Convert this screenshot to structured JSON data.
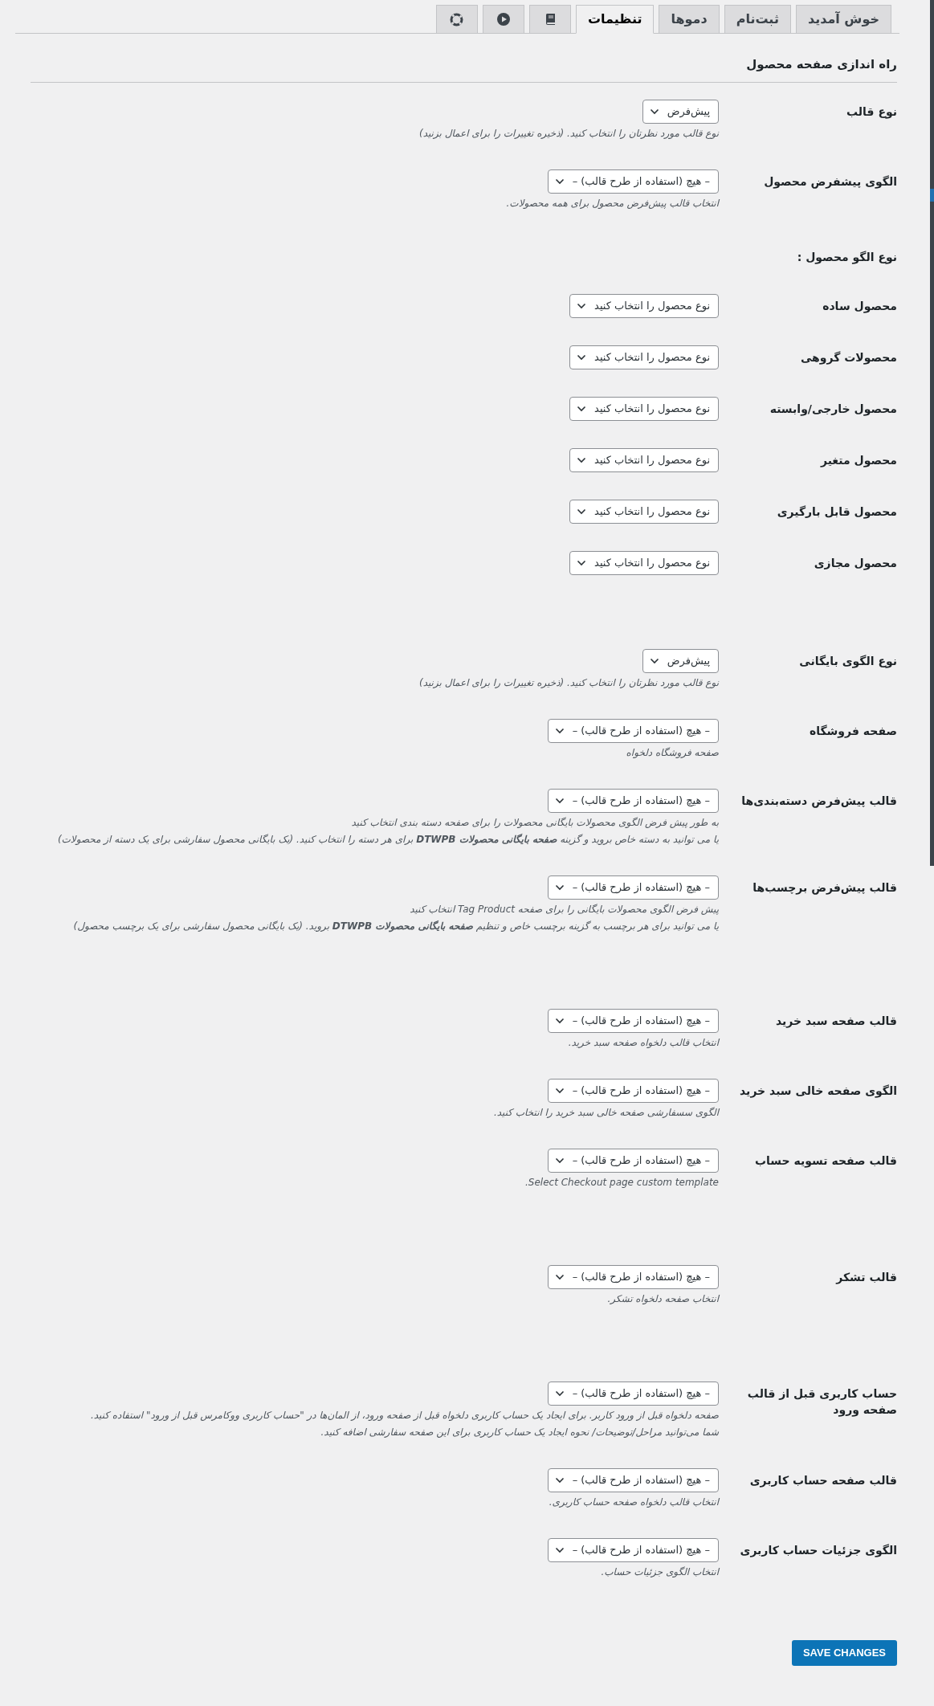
{
  "tabs": [
    {
      "kind": "text",
      "label": "خوش آمدید",
      "selected": false
    },
    {
      "kind": "text",
      "label": "ثبت‌نام",
      "selected": false
    },
    {
      "kind": "text",
      "label": "دموها",
      "selected": false
    },
    {
      "kind": "text",
      "label": "تنظیمات",
      "selected": true
    },
    {
      "kind": "book",
      "selected": false
    },
    {
      "kind": "play",
      "selected": false
    },
    {
      "kind": "lifebuoy",
      "selected": false
    }
  ],
  "sections": [
    {
      "title": "راه اندازی صفحه محصول",
      "rows": [
        {
          "label": "نوع قالب",
          "value": "پیش‌فرض",
          "description": [
            "نوع قالب مورد نظرتان را انتخاب کنید. (ذخیره تغییرات را برای اعمال بزنید)"
          ]
        },
        {
          "label": "الگوی پیشفرض محصول",
          "value": "– هیچ (استفاده از طرح قالب) –",
          "description": [
            "انتخاب قالب پیش‌فرض محصول برای همه محصولات."
          ]
        }
      ]
    },
    {
      "subtitle": "نوع الگو محصول :",
      "rows": [
        {
          "label": "محصول ساده",
          "value": "نوع محصول را انتخاب کنید"
        },
        {
          "label": "محصولات گروهی",
          "value": "نوع محصول را انتخاب کنید"
        },
        {
          "label": "محصول خارجی/وابسته",
          "value": "نوع محصول را انتخاب کنید"
        },
        {
          "label": "محصول متغیر",
          "value": "نوع محصول را انتخاب کنید"
        },
        {
          "label": "محصول قابل بارگیری",
          "value": "نوع محصول را انتخاب کنید"
        },
        {
          "label": "محصول مجازی",
          "value": "نوع محصول را انتخاب کنید"
        }
      ]
    },
    {
      "rows": [
        {
          "label": "نوع الگوی بایگانی",
          "value": "پیش‌فرض",
          "description": [
            "نوع قالب مورد نظرتان را انتخاب کنید. (ذخیره تغییرات را برای اعمال بزنید)"
          ]
        },
        {
          "label": "صفحه فروشگاه",
          "value": "– هیچ (استفاده از طرح قالب) –",
          "description": [
            "صفحه فروشگاه دلخواه"
          ]
        },
        {
          "label": "قالب پیش‌فرض دسته‌بندی‌ها",
          "value": "– هیچ (استفاده از طرح قالب) –",
          "description": [
            "به طور پیش فرض الگوی محصولات بایگانی محصولات را برای صفحه دسته بندی انتخاب کنید",
            "یا می توانید به دسته خاص بروید و گزینه **صفحه بایگانی محصولات DTWPB** برای هر دسته را انتخاب کنید. (یک بایگانی محصول سفارشی برای یک دسته از محصولات)"
          ]
        },
        {
          "label": "قالب پیش‌فرض برچسب‌ها",
          "value": "– هیچ (استفاده از طرح قالب) –",
          "description": [
            "پیش فرض الگوی محصولات بایگانی را برای صفحه Tag Product انتخاب کنید",
            "یا می توانید برای هر برچسب به گزینه برچسب خاص و تنظیم **صفحه بایگانی محصولات DTWPB** بروید. (یک بایگانی محصول سفارشی برای یک برچسب محصول)"
          ]
        }
      ]
    },
    {
      "rows": [
        {
          "label": "قالب صفحه سبد خرید",
          "value": "– هیچ (استفاده از طرح قالب) –",
          "description": [
            "انتخاب قالب دلخواه صفحه سبد خرید."
          ]
        },
        {
          "label": "الگوی صفحه خالی سبد خرید",
          "value": "– هیچ (استفاده از طرح قالب) –",
          "description": [
            "الگوی سسفارشی صفحه خالی سبد خرید را انتخاب کنید."
          ]
        },
        {
          "label": "قالب صفحه تسویه حساب",
          "value": "– هیچ (استفاده از طرح قالب) –",
          "description": [
            "Select Checkout page custom template."
          ]
        }
      ]
    },
    {
      "rows": [
        {
          "label": "قالب تشکر",
          "value": "– هیچ (استفاده از طرح قالب) –",
          "description": [
            "انتخاب صفحه دلخواه تشکر."
          ]
        }
      ]
    },
    {
      "rows": [
        {
          "label": "حساب کاربری قبل از قالب صفحه ورود",
          "value": "– هیچ (استفاده از طرح قالب) –",
          "description": [
            "صفحه دلخواه قبل از ورود کاربر. برای ایجاد یک حساب کاربری دلخواه قبل از صفحه ورود، از المان‌ها در \"حساب کاربری ووکامرس قبل از ورود\" استفاده کنید.",
            "شما می‌توانید مراحل/توضیحات/ نحوه ایجاد یک حساب کاربری برای این صفحه سفارشی اضافه کنید."
          ]
        },
        {
          "label": "قالب صفحه حساب کاربری",
          "value": "– هیچ (استفاده از طرح قالب) –",
          "description": [
            "انتخاب قالب دلخواه صفحه حساب کاربری."
          ]
        },
        {
          "label": "الگوی جزئیات حساب کاربری",
          "value": "– هیچ (استفاده از طرح قالب) –",
          "description": [
            "انتخاب الگوی جزئیات حساب."
          ]
        }
      ]
    }
  ],
  "save_button": "SAVE CHANGES"
}
